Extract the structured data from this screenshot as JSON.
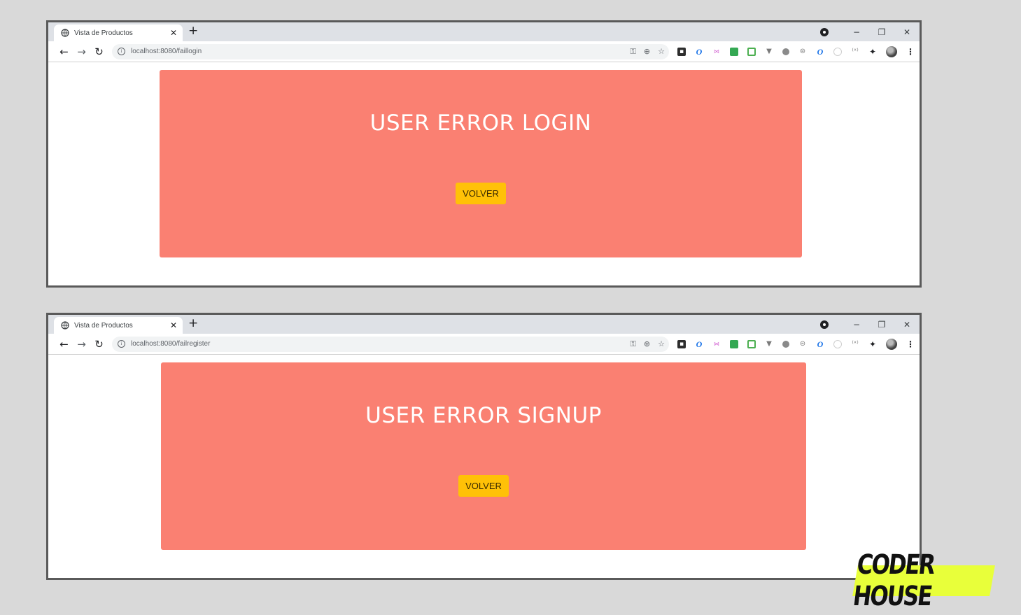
{
  "windows": [
    {
      "tab_title": "Vista de Productos",
      "url": "localhost:8080/faillogin",
      "heading": "USER ERROR LOGIN",
      "button_label": "VOLVER"
    },
    {
      "tab_title": "Vista de Productos",
      "url": "localhost:8080/failregister",
      "heading": "USER ERROR SIGNUP",
      "button_label": "VOLVER"
    }
  ],
  "brand": "CODER HOUSE",
  "colors": {
    "panel": "#fa8072",
    "button": "#ffc107",
    "brand_bg": "#e8ff3a"
  }
}
